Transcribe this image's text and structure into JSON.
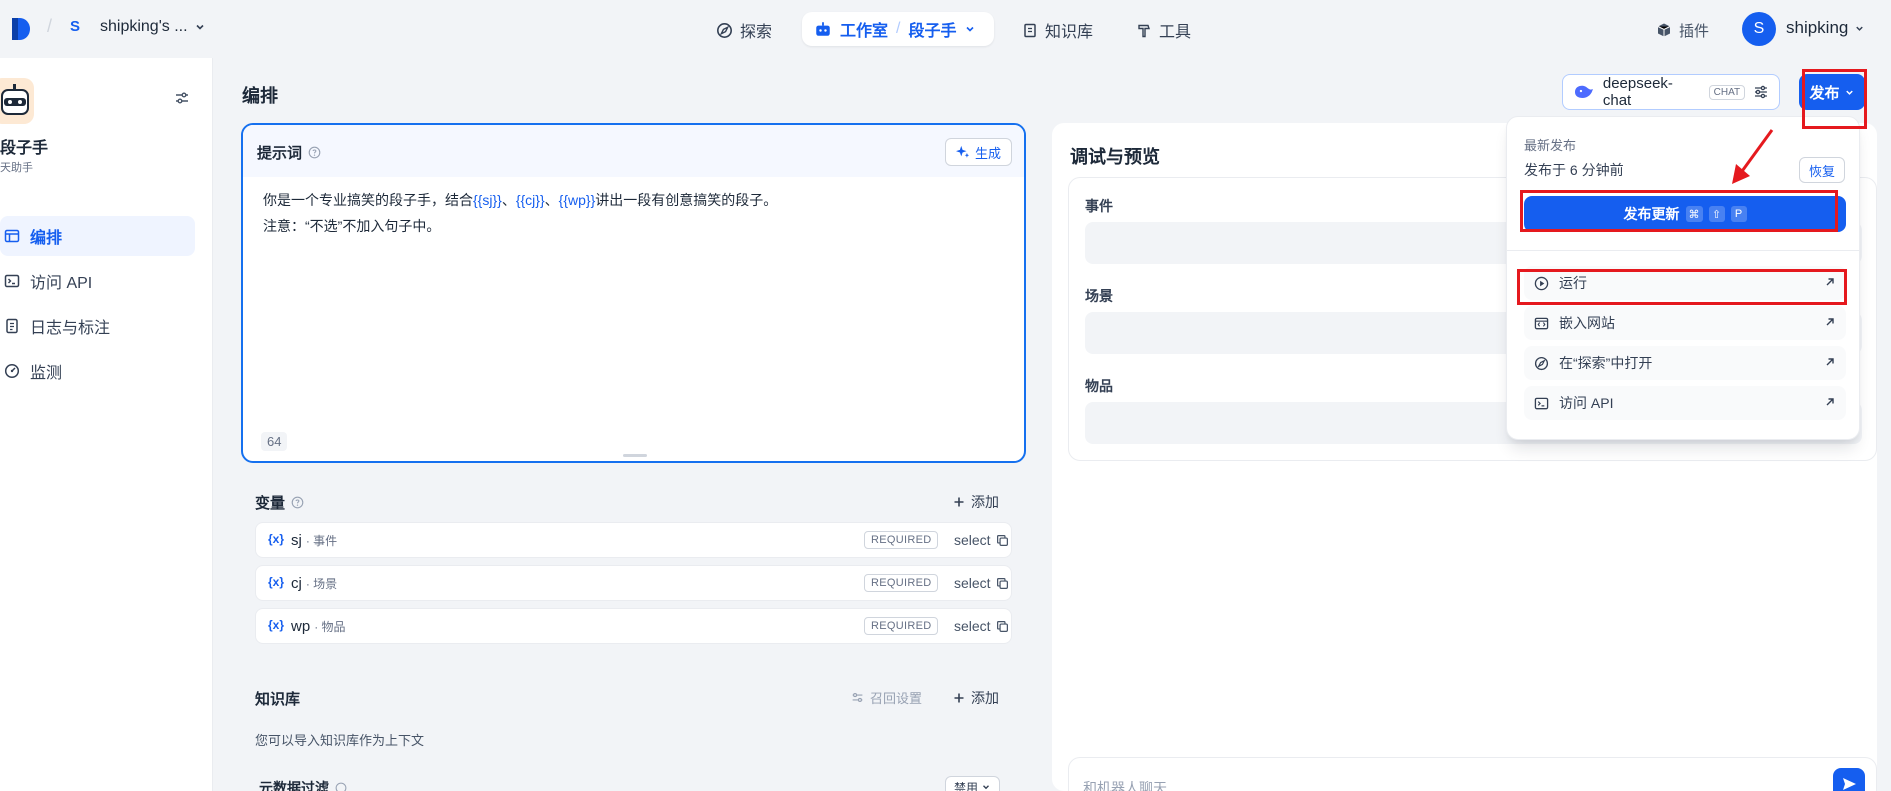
{
  "topnav": {
    "workspace_initial": "S",
    "workspace_name": "shipking's ...",
    "explore": "探索",
    "studio": "工作室",
    "studio_sep": "/",
    "current_app": "段子手",
    "knowledge": "知识库",
    "tools": "工具",
    "plugins": "插件",
    "user_initial": "S",
    "user_name": "shipking"
  },
  "sidebar": {
    "app_name": "段子手",
    "app_desc": "天助手",
    "items": [
      {
        "label": "编排",
        "active": true
      },
      {
        "label": "访问 API"
      },
      {
        "label": "日志与标注"
      },
      {
        "label": "监测"
      }
    ]
  },
  "header": {
    "title": "编排",
    "model_name": "deepseek-chat",
    "model_badge": "CHAT",
    "publish_label": "发布"
  },
  "prompt": {
    "title": "提示词",
    "generate_label": "生成",
    "line1_a": "你是一个专业搞笑的段子手，结合",
    "var1": "{{sj}}",
    "sep1": "、",
    "var2": "{{cj}}",
    "sep2": "、",
    "var3": "{{wp}}",
    "line1_b": "讲出一段有创意搞笑的段子。",
    "line2": "注意：“不选”不加入句子中。",
    "char_count": "64"
  },
  "variables": {
    "title": "变量",
    "add_label": "添加",
    "rows": [
      {
        "icon": "{x}",
        "key": "sj",
        "label": "· 事件",
        "required": "REQUIRED",
        "type": "select"
      },
      {
        "icon": "{x}",
        "key": "cj",
        "label": "· 场景",
        "required": "REQUIRED",
        "type": "select"
      },
      {
        "icon": "{x}",
        "key": "wp",
        "label": "· 物品",
        "required": "REQUIRED",
        "type": "select"
      }
    ]
  },
  "knowledge": {
    "title": "知识库",
    "recall_label": "召回设置",
    "add_label": "添加",
    "desc": "您可以导入知识库作为上下文",
    "meta_filter": "元数据过滤",
    "meta_status": "禁用"
  },
  "debug": {
    "title": "调试与预览",
    "fields": [
      "事件",
      "场景",
      "物品"
    ],
    "chat_placeholder": "和机器人聊天"
  },
  "dropdown": {
    "section_title": "最新发布",
    "time": "发布于 6 分钟前",
    "restore": "恢复",
    "publish_update": "发布更新",
    "keys": [
      "⌘",
      "⇧",
      "P"
    ],
    "items": [
      {
        "label": "运行",
        "icon": "play-circle-icon"
      },
      {
        "label": "嵌入网站",
        "icon": "embed-icon"
      },
      {
        "label": "在“探索”中打开",
        "icon": "compass-icon"
      },
      {
        "label": "访问 API",
        "icon": "terminal-icon"
      }
    ]
  },
  "colors": {
    "accent": "#155eef",
    "annotation": "#e5191e"
  }
}
